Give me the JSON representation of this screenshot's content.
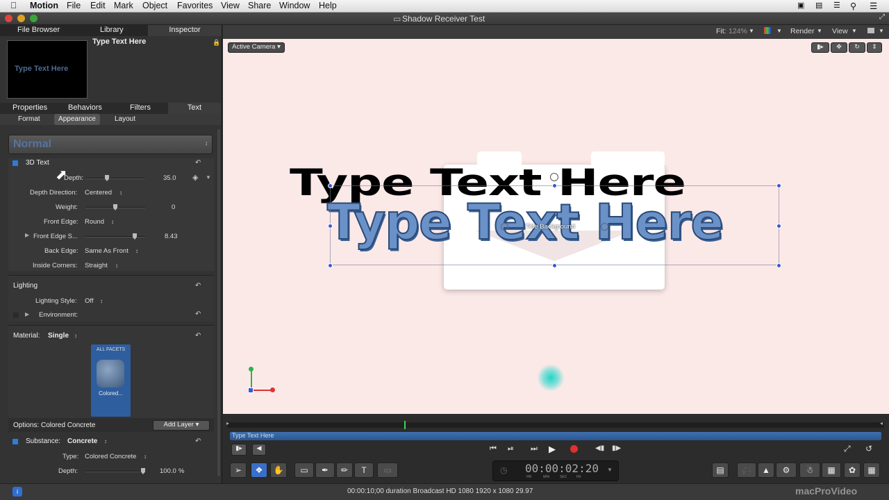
{
  "menubar": {
    "apple": "",
    "app": "Motion",
    "items": [
      "File",
      "Edit",
      "Mark",
      "Object",
      "Favorites",
      "View",
      "Share",
      "Window",
      "Help"
    ]
  },
  "window": {
    "title": "Shadow Receiver Test"
  },
  "left_tabs": [
    "File Browser",
    "Library",
    "Inspector"
  ],
  "preview": {
    "text": "Type Text Here",
    "title": "Type Text Here"
  },
  "inspector_tabs": [
    "Properties",
    "Behaviors",
    "Filters",
    "Text"
  ],
  "text_subtabs": [
    "Format",
    "Appearance",
    "Layout"
  ],
  "preset": "Normal",
  "text3d": {
    "title": "3D Text",
    "depth_label": "Depth:",
    "depth_value": "35.0",
    "depth_direction_label": "Depth Direction:",
    "depth_direction": "Centered",
    "weight_label": "Weight:",
    "weight_value": "0",
    "front_edge_label": "Front Edge:",
    "front_edge": "Round",
    "front_edge_size_label": "Front Edge S...",
    "front_edge_size": "8.43",
    "back_edge_label": "Back Edge:",
    "back_edge": "Same As Front",
    "inside_corners_label": "Inside Corners:",
    "inside_corners": "Straight"
  },
  "lighting": {
    "title": "Lighting",
    "style_label": "Lighting Style:",
    "style": "Off",
    "environment_label": "Environment:"
  },
  "material": {
    "label": "Material:",
    "value": "Single",
    "facets_label": "ALL FACETS",
    "swatch_label": "Colored..."
  },
  "options": {
    "label": "Options: Colored Concrete",
    "add_layer": "Add Layer"
  },
  "substance": {
    "label": "Substance:",
    "value": "Concrete",
    "type_label": "Type:",
    "type": "Colored Concrete",
    "depth_label": "Depth:",
    "depth_value": "100.0",
    "depth_unit": "%"
  },
  "viewer": {
    "fit_label": "Fit:",
    "fit_value": "124%",
    "render": "Render",
    "view": "View",
    "camera": "Active Camera"
  },
  "canvas": {
    "main_text": "Type Text Here",
    "bg_label": "Title Background"
  },
  "timeline": {
    "clip_label": "Type Text Here",
    "playhead_fraction": 0.27
  },
  "timecode": {
    "value": "00:00:02:20",
    "units": [
      "HR",
      "MIN",
      "SEC",
      "FR"
    ]
  },
  "status": {
    "text": "00:00:10;00 duration Broadcast HD 1080 1920 x 1080 29.97"
  },
  "watermark": "macProVideo"
}
